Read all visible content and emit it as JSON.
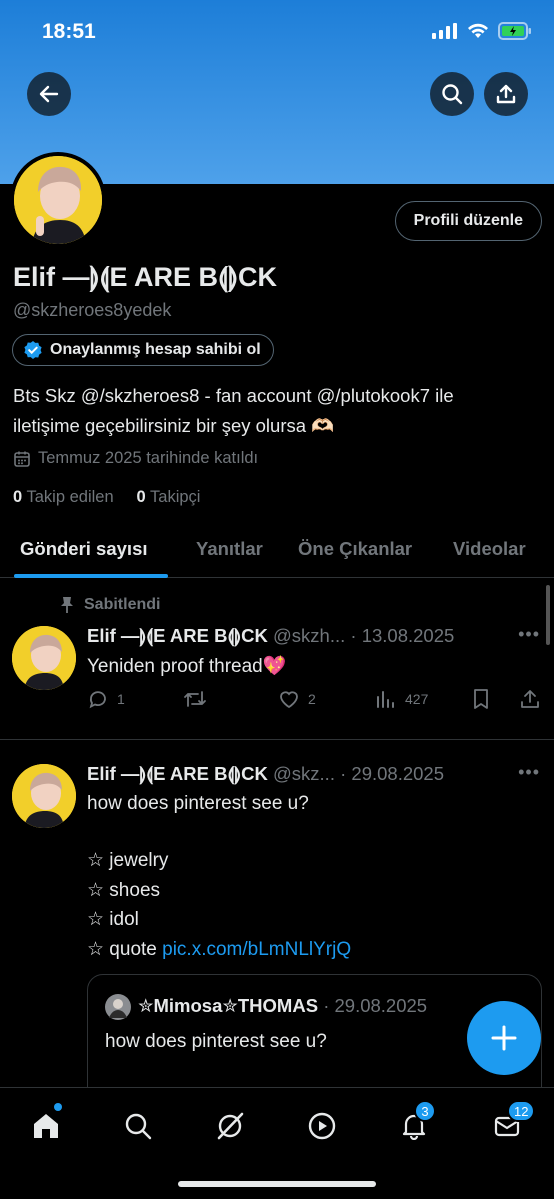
{
  "status_bar": {
    "time": "18:51"
  },
  "profile": {
    "edit_button": "Profili düzenle",
    "name": "Elif —⟭⟬E ARE B⟬⟭CK",
    "handle": "@skzheroes8yedek",
    "verify_button": "Onaylanmış hesap sahibi ol",
    "bio_line1": "Bts Skz @/skzheroes8 - fan account @/plutokook7 ile",
    "bio_line2": "iletişime geçebilirsiniz bir şey olursa 🫶🏻",
    "joined": "Temmuz 2025 tarihinde katıldı",
    "following_count": "0",
    "following_label": "Takip edilen",
    "followers_count": "0",
    "followers_label": "Takipçi"
  },
  "tabs": [
    {
      "label": "Gönderi sayısı"
    },
    {
      "label": "Yanıtlar"
    },
    {
      "label": "Öne Çıkanlar"
    },
    {
      "label": "Videolar"
    }
  ],
  "pinned_label": "Sabitlendi",
  "tweets": [
    {
      "name": "Elif —⟭⟬E ARE B⟬⟭CK",
      "handle_date": "@skzh... · 13.08.2025",
      "text": "Yeniden proof thread💖",
      "replies": "1",
      "likes": "2",
      "views": "427"
    },
    {
      "name": "Elif —⟭⟬E ARE B⟬⟭CK",
      "handle_date": "@skz... · 29.08.2025",
      "line1": "how does pinterest see u?",
      "line2": "☆ jewelry",
      "line3": "☆ shoes",
      "line4": "☆ idol",
      "line5_prefix": "☆ quote ",
      "link": "pic.x.com/bLmNLlYrjQ",
      "quote": {
        "name": "✮Mimosa✮THOMAS",
        "date": "· 29.08.2025",
        "text": "how does pinterest see u?"
      }
    }
  ],
  "bottom_nav": {
    "notifications_badge": "3",
    "messages_badge": "12"
  },
  "colors": {
    "accent": "#1d9bf0",
    "background": "#000000",
    "banner": "#3b8fe0"
  }
}
